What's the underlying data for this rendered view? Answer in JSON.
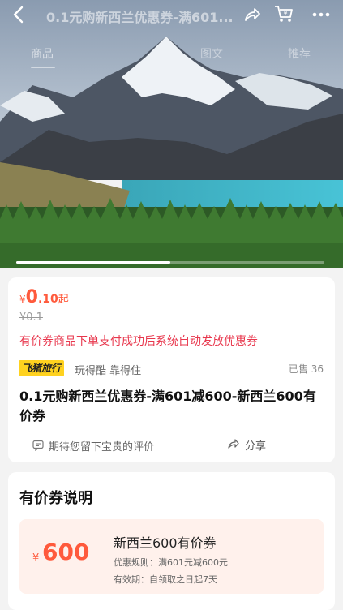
{
  "nav": {
    "title": "0.1元购新西兰优惠券-满601...",
    "icons": [
      "back-icon",
      "share-icon",
      "cart-icon",
      "more-icon"
    ]
  },
  "tabs": [
    {
      "label": "商品"
    },
    {
      "label": "图文"
    },
    {
      "label": "推荐"
    }
  ],
  "gallery": {
    "progress": 0.5
  },
  "product": {
    "price": {
      "currency": "¥",
      "int": "0",
      "dec": ".10",
      "suffix": "起"
    },
    "original_price": "¥0.1",
    "notice": "有价券商品下单支付成功后系统自动发放优惠券",
    "brand": "飞猪旅行",
    "slogan": "玩得酷 靠得住",
    "sold": "已售 36",
    "title": "0.1元购新西兰优惠券-满601减600-新西兰600有价券",
    "review_prompt": "期待您留下宝贵的评价",
    "share_label": "分享"
  },
  "coupon_section": {
    "title": "有价券说明",
    "coupon": {
      "currency": "¥",
      "amount": "600",
      "name": "新西兰600有价券",
      "rule": "优惠规则：满601元减600元",
      "validity": "有效期：自领取之日起7天"
    }
  },
  "colors": {
    "accent": "#ff5a3c",
    "notice": "#e8374d",
    "brand_badge": "#ffd21f"
  }
}
